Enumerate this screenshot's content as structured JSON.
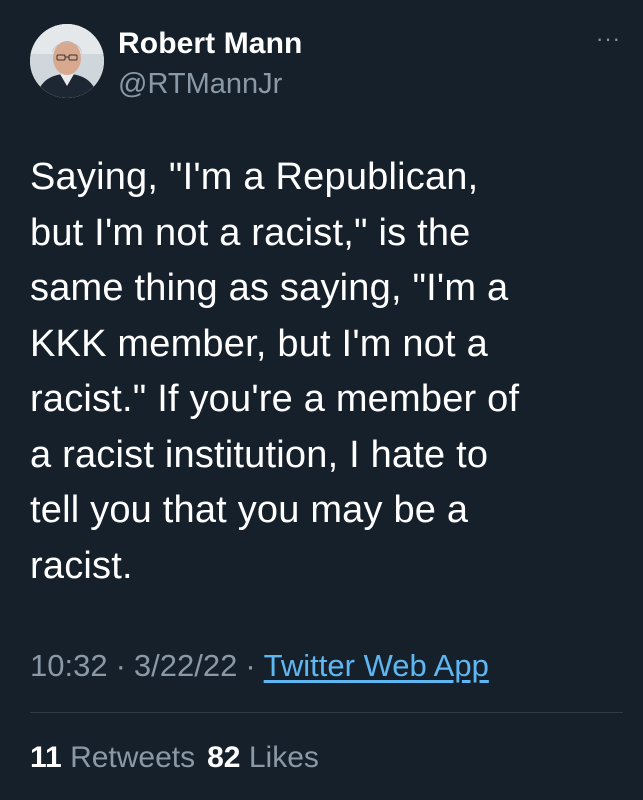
{
  "author": {
    "display_name": "Robert Mann",
    "handle": "@RTMannJr"
  },
  "more_menu": "···",
  "tweet": {
    "text": "Saying, \"I'm a Republican,\nbut I'm not a racist,\" is the\nsame thing as saying, \"I'm a\nKKK member, but I'm not a\nracist.\" If you're a member of\na racist institution, I hate to\ntell you that you may be a\nracist."
  },
  "meta": {
    "time": "10:32",
    "separator": "·",
    "date": "3/22/22",
    "source": "Twitter Web App"
  },
  "stats": {
    "retweets_count": "11",
    "retweets_label": "Retweets",
    "likes_count": "82",
    "likes_label": "Likes"
  },
  "colors": {
    "background": "#16202b",
    "text_primary": "#ffffff",
    "text_secondary": "#8b99a6",
    "link": "#5eb7f2"
  }
}
